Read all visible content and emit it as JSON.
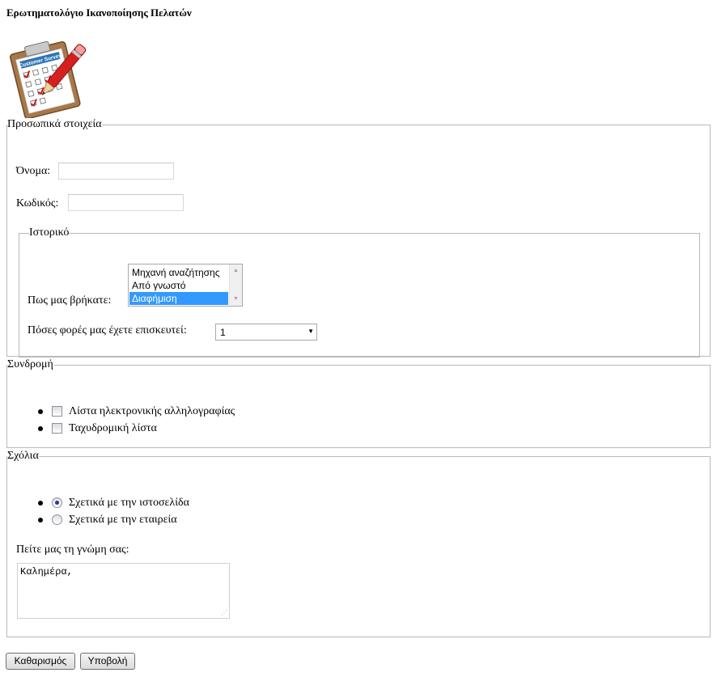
{
  "page": {
    "title": "Ερωτηματολόγιο Ικανοποίησης Πελατών",
    "logo_text": "Customer Survey"
  },
  "personal": {
    "legend": "Προσωπικά στοιχεία",
    "name_label": "Όνομα:",
    "name_value": "",
    "code_label": "Κωδικός:",
    "code_value": ""
  },
  "history": {
    "legend": "Ιστορικό",
    "found_label": "Πως μας βρήκατε:",
    "found_options": [
      "Μηχανή αναζήτησης",
      "Από γνωστό",
      "Διαφήμιση"
    ],
    "found_selected": "Διαφήμιση",
    "visits_label": "Πόσες φορές μας έχετε επισκευτεί:",
    "visits_value": "1"
  },
  "subscription": {
    "legend": "Συνδρομή",
    "items": [
      {
        "label": "Λίστα ηλεκτρονικής αλληλογραφίας",
        "checked": false
      },
      {
        "label": "Ταχυδρομική λίστα",
        "checked": false
      }
    ]
  },
  "comments": {
    "legend": "Σχόλια",
    "options": [
      {
        "label": "Σχετικά με την ιστοσελίδα",
        "checked": true
      },
      {
        "label": "Σχετικά με την εταιρεία",
        "checked": false
      }
    ],
    "opinion_label": "Πείτε μας τη γνώμη σας:",
    "opinion_value": "Καλημέρα,"
  },
  "buttons": {
    "reset_label": "Καθαρισμός",
    "submit_label": "Υποβολή"
  },
  "colors": {
    "selection": "#3399ff",
    "fieldset_border": "#b9b9b9"
  }
}
